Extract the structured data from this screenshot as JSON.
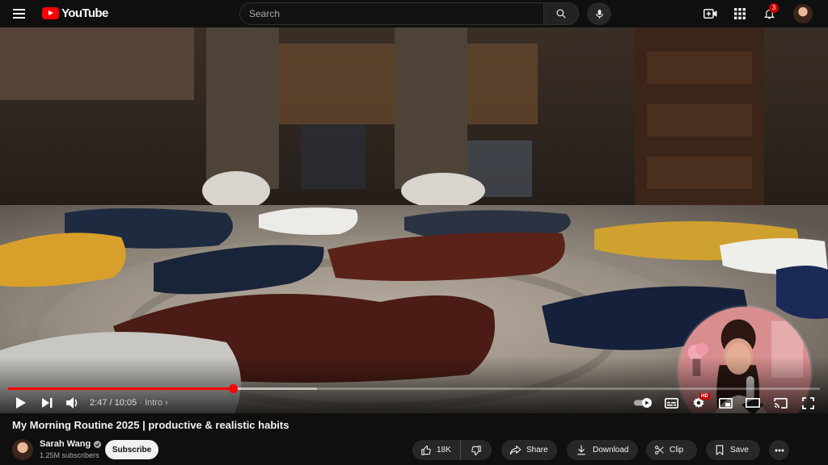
{
  "header": {
    "logo_text": "YouTube",
    "search_placeholder": "Search",
    "notification_count": "3",
    "icons": [
      "menu-icon",
      "search-icon",
      "mic-icon",
      "create-icon",
      "apps-icon",
      "bell-icon"
    ]
  },
  "player": {
    "current_time": "2:47",
    "duration": "10:05",
    "chapter": "Intro",
    "progress": 0.277,
    "autoplay": "on",
    "quality_badge": "HD",
    "controls": [
      "play-icon",
      "next-icon",
      "volume-icon",
      "autoplay-toggle",
      "subtitles-icon",
      "settings-icon",
      "miniplayer-icon",
      "theater-icon",
      "cast-icon",
      "fullscreen-icon"
    ]
  },
  "video": {
    "title": "My Morning Routine 2025 | productive & realistic habits"
  },
  "channel": {
    "name": "Sarah Wang",
    "subscribers": "1.25M subscribers",
    "subscribe_label": "Subscribe"
  },
  "actions": {
    "like_count": "18K",
    "share_label": "Share",
    "download_label": "Download",
    "clip_label": "Clip",
    "save_label": "Save"
  },
  "colors": {
    "background": "#0f0f0f",
    "accent": "#ff0000",
    "pill": "#272727"
  }
}
